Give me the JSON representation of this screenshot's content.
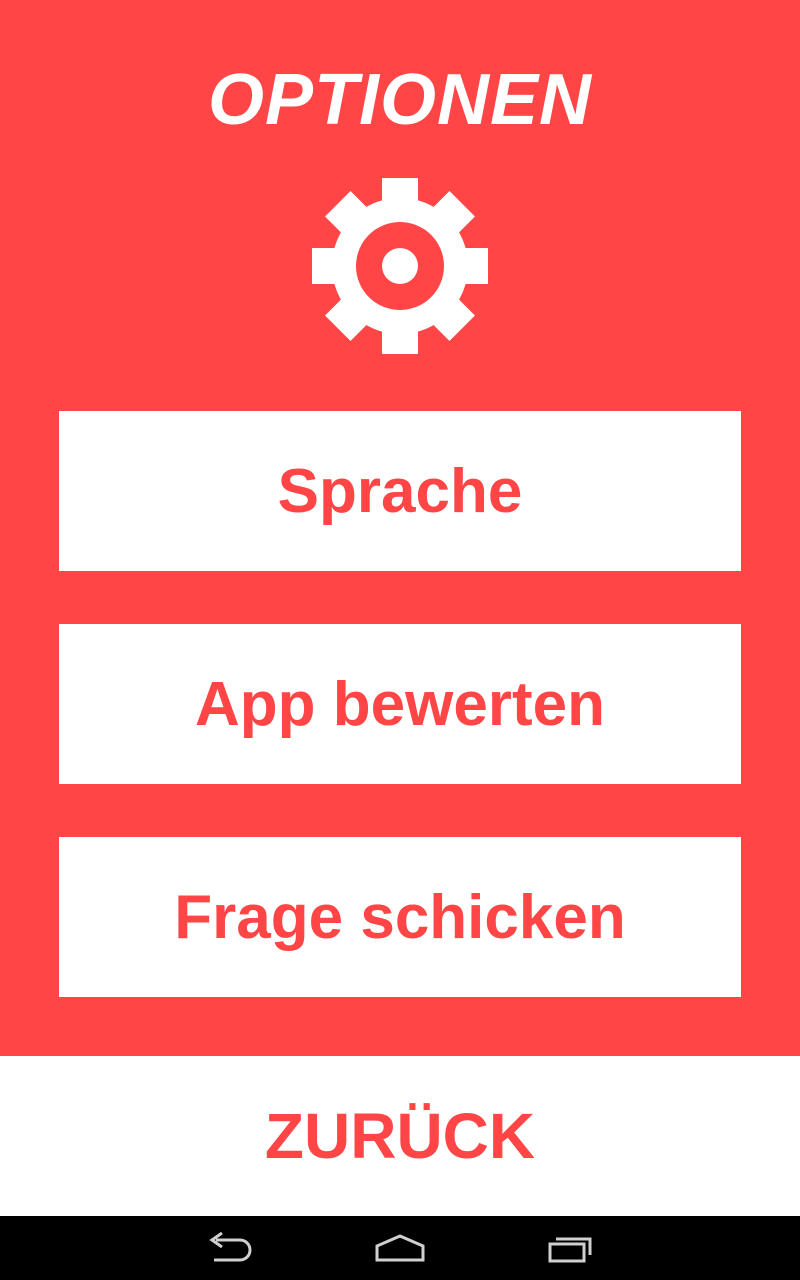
{
  "header": {
    "title": "OPTIONEN",
    "icon": "gear-icon"
  },
  "menu": {
    "items": [
      {
        "label": "Sprache"
      },
      {
        "label": "App bewerten"
      },
      {
        "label": "Frage schicken"
      }
    ]
  },
  "footer": {
    "back_label": "ZURÜCK"
  },
  "system_nav": {
    "icons": [
      "back-icon",
      "home-icon",
      "recent-apps-icon"
    ]
  },
  "colors": {
    "accent": "#ff4545",
    "surface": "#ffffff",
    "nav_bar": "#000000"
  }
}
